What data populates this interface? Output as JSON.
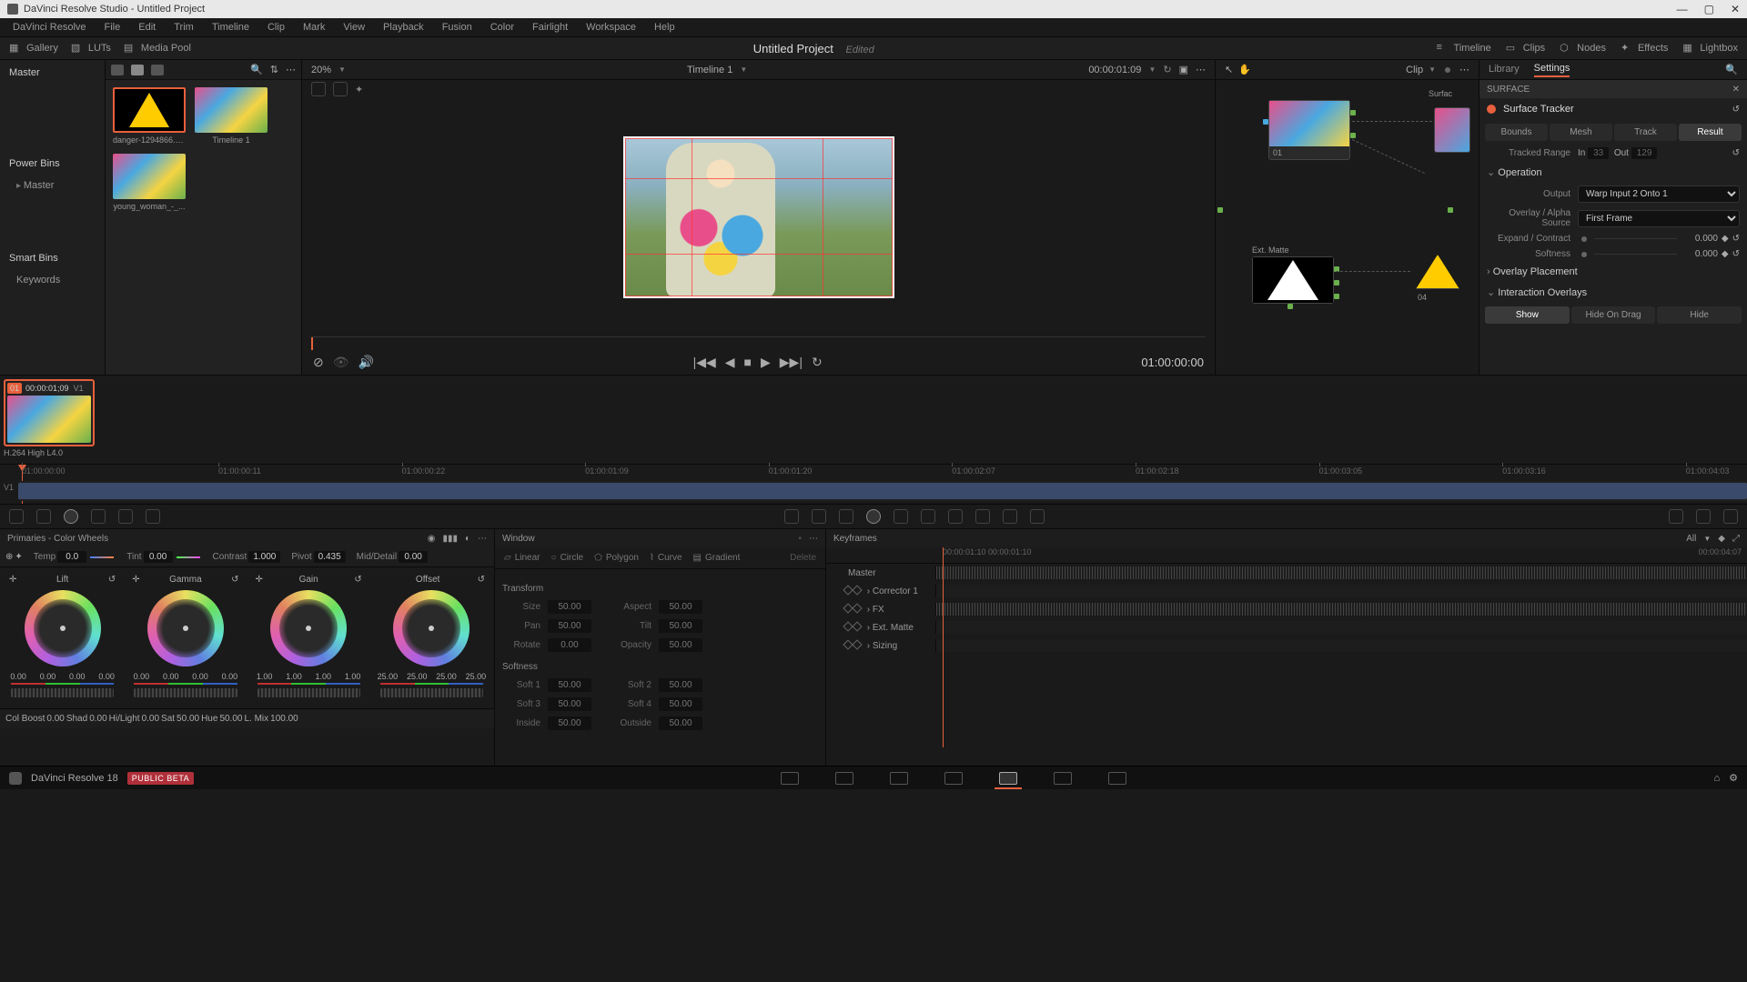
{
  "app_title": "DaVinci Resolve Studio - Untitled Project",
  "menu": [
    "DaVinci Resolve",
    "File",
    "Edit",
    "Trim",
    "Timeline",
    "Clip",
    "Mark",
    "View",
    "Playback",
    "Fusion",
    "Color",
    "Fairlight",
    "Workspace",
    "Help"
  ],
  "toolbar": {
    "gallery": "Gallery",
    "luts": "LUTs",
    "media_pool": "Media Pool",
    "project": "Untitled Project",
    "edited": "Edited",
    "timeline": "Timeline",
    "clips": "Clips",
    "nodes": "Nodes",
    "effects": "Effects",
    "lightbox": "Lightbox"
  },
  "mediapool": {
    "master": "Master",
    "powerbins": "Power Bins",
    "pb_master": "Master",
    "smartbins": "Smart Bins",
    "keywords": "Keywords",
    "thumbs": [
      {
        "label": "danger-1294866.p..."
      },
      {
        "label": "Timeline 1"
      },
      {
        "label": "young_woman_-_..."
      }
    ]
  },
  "viewer": {
    "zoom": "20%",
    "timeline_name": "Timeline 1",
    "timecode": "00:00:01:09",
    "tc_display": "01:00:00:00"
  },
  "nodegraph": {
    "clip_label": "Clip",
    "surface_label": "Surfac",
    "extmatte": "Ext. Matte",
    "n01": "01",
    "n04": "04"
  },
  "settings": {
    "library": "Library",
    "settings": "Settings",
    "surface_hdr": "SURFACE",
    "surface_tracker": "Surface Tracker",
    "tabs": {
      "bounds": "Bounds",
      "mesh": "Mesh",
      "track": "Track",
      "result": "Result"
    },
    "tracked_range": "Tracked Range",
    "in_lbl": "In",
    "in_val": "33",
    "out_lbl": "Out",
    "out_val": "129",
    "operation": "Operation",
    "output_lbl": "Output",
    "output_val": "Warp Input 2 Onto 1",
    "overlay_src_lbl": "Overlay / Alpha Source",
    "overlay_src_val": "First Frame",
    "expand_lbl": "Expand / Contract",
    "expand_val": "0.000",
    "softness_lbl": "Softness",
    "softness_val": "0.000",
    "overlay_placement": "Overlay Placement",
    "interaction_overlays": "Interaction Overlays",
    "show": "Show",
    "hide_on_drag": "Hide On Drag",
    "hide": "Hide"
  },
  "clip": {
    "num": "01",
    "tc": "00:00:01;09",
    "track": "V1",
    "codec": "H.264 High L4.0"
  },
  "timeline": {
    "track": "V1",
    "ticks": [
      "01:00:00:00",
      "01:00:00:11",
      "01:00:00:22",
      "01:00:01:09",
      "01:00:01:20",
      "01:00:02:07",
      "01:00:02:18",
      "01:00:03:05",
      "01:00:03:16",
      "01:00:04:03"
    ]
  },
  "primaries": {
    "title": "Primaries - Color Wheels",
    "temp": "Temp",
    "temp_v": "0.0",
    "tint": "Tint",
    "tint_v": "0.00",
    "contrast": "Contrast",
    "contrast_v": "1.000",
    "pivot": "Pivot",
    "pivot_v": "0.435",
    "middetail": "Mid/Detail",
    "middetail_v": "0.00",
    "wheels": {
      "lift": {
        "lbl": "Lift",
        "vals": [
          "0.00",
          "0.00",
          "0.00",
          "0.00"
        ]
      },
      "gamma": {
        "lbl": "Gamma",
        "vals": [
          "0.00",
          "0.00",
          "0.00",
          "0.00"
        ]
      },
      "gain": {
        "lbl": "Gain",
        "vals": [
          "1.00",
          "1.00",
          "1.00",
          "1.00"
        ]
      },
      "offset": {
        "lbl": "Offset",
        "vals": [
          "25.00",
          "25.00",
          "25.00",
          "25.00"
        ]
      }
    },
    "colboost": "Col Boost",
    "colboost_v": "0.00",
    "shad": "Shad",
    "shad_v": "0.00",
    "hilight": "Hi/Light",
    "hilight_v": "0.00",
    "sat": "Sat",
    "sat_v": "50.00",
    "hue": "Hue",
    "hue_v": "50.00",
    "lmix": "L. Mix",
    "lmix_v": "100.00"
  },
  "window": {
    "title": "Window",
    "linear": "Linear",
    "circle": "Circle",
    "polygon": "Polygon",
    "curve": "Curve",
    "gradient": "Gradient",
    "delete": "Delete",
    "transform": "Transform",
    "size": "Size",
    "size_v": "50.00",
    "aspect": "Aspect",
    "aspect_v": "50.00",
    "pan": "Pan",
    "pan_v": "50.00",
    "tilt": "Tilt",
    "tilt_v": "50.00",
    "rotate": "Rotate",
    "rotate_v": "0.00",
    "opacity": "Opacity",
    "opacity_v": "50.00",
    "softness": "Softness",
    "s1": "Soft 1",
    "s1_v": "50.00",
    "s2": "Soft 2",
    "s2_v": "50.00",
    "s3": "Soft 3",
    "s3_v": "50.00",
    "s4": "Soft 4",
    "s4_v": "50.00",
    "inside": "Inside",
    "inside_v": "50.00",
    "outside": "Outside",
    "outside_v": "50.00"
  },
  "keyframes": {
    "title": "Keyframes",
    "all": "All",
    "tc": "00:00:01:10",
    "ticks": [
      "00:00:01:10",
      "00:00:04:07"
    ],
    "rows": [
      "Master",
      "Corrector 1",
      "FX",
      "Ext. Matte",
      "Sizing"
    ]
  },
  "footer": {
    "app": "DaVinci Resolve 18",
    "beta": "PUBLIC BETA"
  }
}
